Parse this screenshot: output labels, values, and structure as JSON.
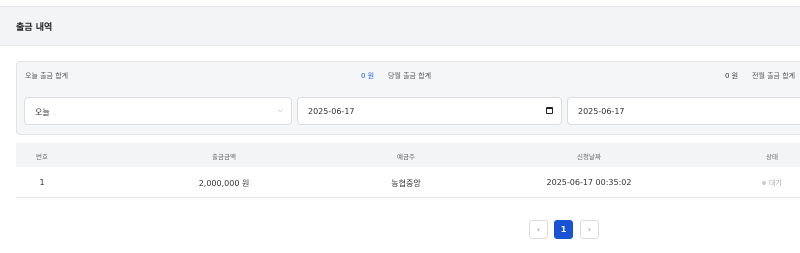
{
  "header": {
    "title": "출금 내역"
  },
  "summary": {
    "today_label": "오늘 출금 합계",
    "today_value": "0 원",
    "month_label": "당월 출금 합계",
    "month_value": "0 원",
    "prev_label": "전월 출금 합계"
  },
  "filters": {
    "period_value": "오늘",
    "start_date": "2025-06-17",
    "end_date": "2025-06-17"
  },
  "table": {
    "headers": [
      "번호",
      "출금금액",
      "예금주",
      "신청날짜",
      "상태"
    ],
    "rows": [
      {
        "no": "1",
        "amount": "2,000,000 원",
        "holder": "농협중앙",
        "date": "2025-06-17 00:35:02",
        "status": "대기"
      }
    ]
  },
  "pagination": {
    "prev": "‹",
    "current": "1",
    "next": "›"
  },
  "colors": {
    "accent": "#1a52d6",
    "value_blue": "#1e5bd8"
  }
}
